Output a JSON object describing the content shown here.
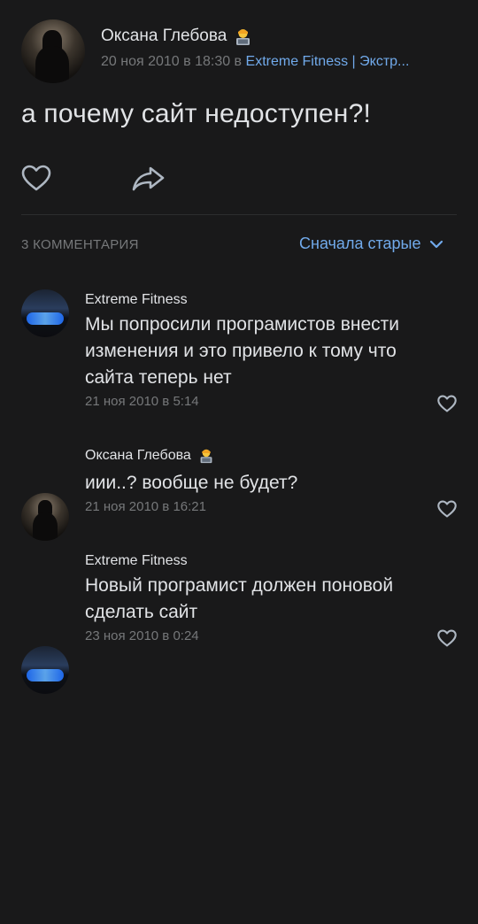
{
  "post": {
    "author": "Оксана Глебова",
    "date": "20 ноя 2010 в 18:30 в",
    "group": "Extreme Fitness | Экстр...",
    "text": "а почему сайт недоступен?!"
  },
  "comments_header": {
    "count": "3 КОММЕНТАРИЯ",
    "sort_label": "Сначала старые"
  },
  "comments": [
    {
      "author": "Extreme Fitness",
      "text": "Мы попросили програмистов внести изменения и это привело к тому что сайта теперь нет",
      "date": "21 ноя 2010 в 5:14"
    },
    {
      "author": "Оксана Глебова",
      "text": "иии..? вообще не будет?",
      "date": "21 ноя 2010 в 16:21"
    },
    {
      "author": "Extreme Fitness",
      "text": "Новый програмист должен поновой сделать сайт",
      "date": "23 ноя 2010 в 0:24"
    }
  ],
  "icons": {
    "like": "heart-icon",
    "share": "share-icon",
    "sort": "chevron-down-icon",
    "emoji": "person-with-laptop-emoji"
  },
  "colors": {
    "background": "#19191a",
    "text": "#e1e3e6",
    "secondary": "#76787a",
    "accent": "#71aaeb"
  }
}
